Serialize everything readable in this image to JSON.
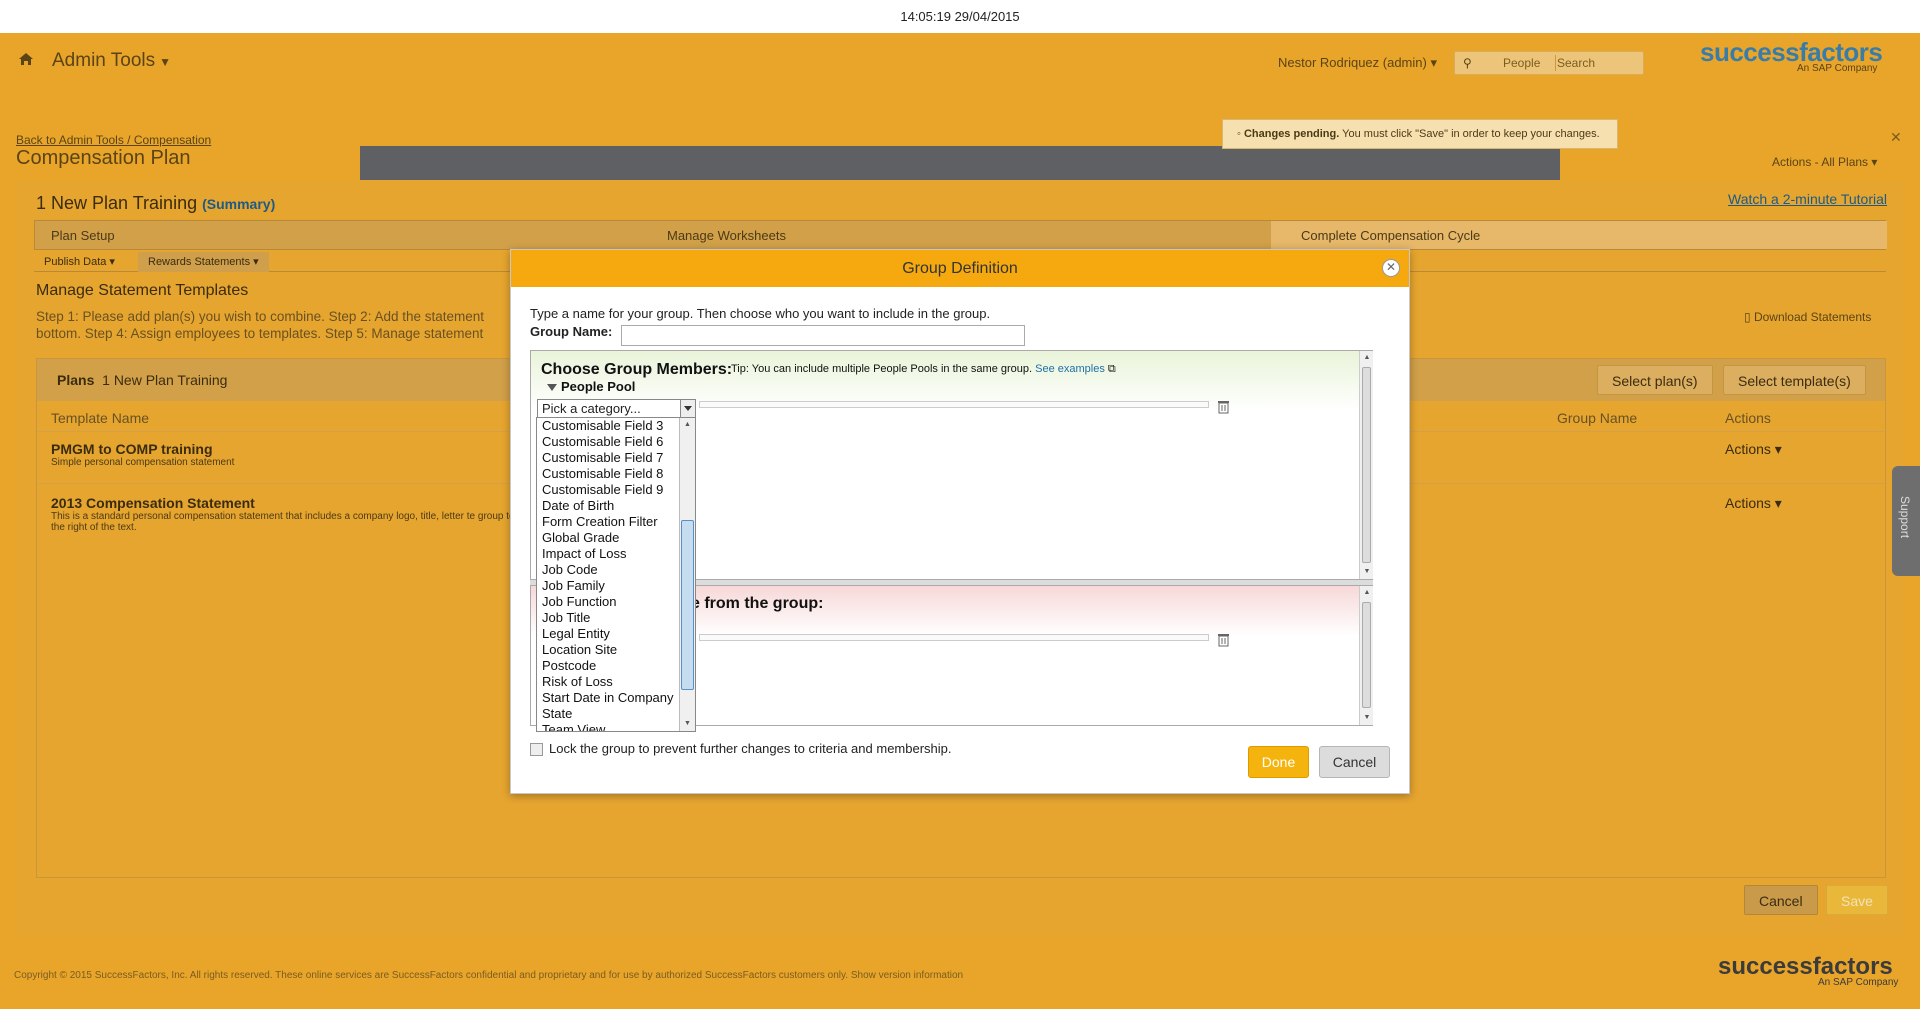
{
  "clock": "14:05:19 29/04/2015",
  "header": {
    "admin_tools": "Admin Tools",
    "user": "Nestor Rodriquez (admin)",
    "search_scope": "People",
    "search_placeholder": "Search",
    "logo": "successfactors",
    "logo_sub": "An SAP Company"
  },
  "breadcrumb": "Back to Admin Tools / Compensation",
  "page_title": "Compensation Plan",
  "pending": {
    "bold": "Changes pending.",
    "text": "You must click \"Save\" in order to keep your changes."
  },
  "actions_all": "Actions - All Plans",
  "plan": {
    "name": "1 New Plan Training",
    "summary": "(Summary)",
    "tutorial": "Watch a 2-minute Tutorial",
    "steps": [
      "Plan Setup",
      "Manage Worksheets",
      "Complete Compensation Cycle"
    ],
    "subtabs": [
      "Publish Data",
      "Rewards Statements"
    ],
    "section_title": "Manage Statement Templates",
    "instructions": "Step 1: Please add plan(s) you wish to combine. Step 2: Add the statement bottom. Step 4: Assign employees to templates. Step 5: Manage statement",
    "download": "Download Statements"
  },
  "grid": {
    "plans_label": "Plans",
    "plans_value": "1 New Plan Training",
    "select_plans": "Select plan(s)",
    "select_templates": "Select template(s)",
    "col_template": "Template Name",
    "col_group": "Group Name",
    "col_actions": "Actions",
    "rows": [
      {
        "title": "PMGM to COMP training",
        "desc": "Simple personal compensation statement",
        "actions": "Actions"
      },
      {
        "title": "2013 Compensation Statement",
        "desc": "This is a standard personal compensation statement that includes a company logo, title, letter te group to the right of the text.",
        "actions": "Actions"
      }
    ],
    "cancel": "Cancel",
    "save": "Save"
  },
  "footer": {
    "copyright": "Copyright © 2015 SuccessFactors, Inc. All rights reserved. These online services are SuccessFactors confidential and proprietary and for use by authorized SuccessFactors customers only. Show version information",
    "logo": "successfactors",
    "logo_sub": "An SAP Company"
  },
  "support": "Support",
  "modal": {
    "title": "Group Definition",
    "intro": "Type a name for your group. Then choose who you want to include in the group.",
    "group_name_label": "Group Name:",
    "group_name_value": "",
    "include_title": "Choose Group Members:",
    "tip": "Tip: You can include multiple People Pools in the same group.",
    "see_examples": "See examples",
    "people_pool": "People Pool",
    "category_placeholder": "Pick a category...",
    "exclude_title": "e from the group:",
    "categories": [
      "Customisable Field 3",
      "Customisable Field 6",
      "Customisable Field 7",
      "Customisable Field 8",
      "Customisable Field 9",
      "Date of Birth",
      "Form Creation Filter",
      "Global Grade",
      "Impact of Loss",
      "Job Code",
      "Job Family",
      "Job Function",
      "Job Title",
      "Legal Entity",
      "Location Site",
      "Postcode",
      "Risk of Loss",
      "Start Date in Company",
      "State",
      "Team View"
    ],
    "lock_label": "Lock the group to prevent further changes to criteria and membership.",
    "done": "Done",
    "cancel": "Cancel"
  }
}
